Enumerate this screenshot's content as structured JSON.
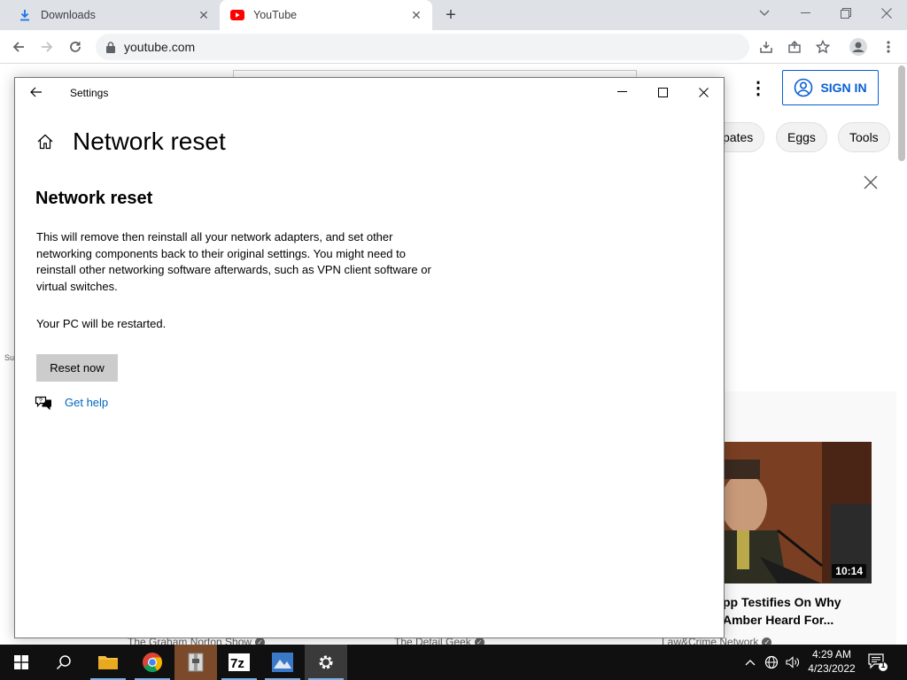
{
  "browser": {
    "tabs": [
      {
        "label": "Downloads",
        "icon": "download-icon",
        "active": false
      },
      {
        "label": "YouTube",
        "icon": "youtube-icon",
        "active": true
      }
    ],
    "url": "youtube.com"
  },
  "youtube": {
    "sign_in_label": "SIGN IN",
    "chips": [
      "pates",
      "Eggs",
      "Tools"
    ],
    "partial_left_text": "Su",
    "video": {
      "duration": "10:14",
      "title_line1": "pp Testifies On Why",
      "title_line2": "Amber Heard For..."
    },
    "channels": [
      "The Graham Norton Show",
      "The Detail Geek",
      "Law&Crime Network"
    ]
  },
  "settings": {
    "window_title": "Settings",
    "page_title": "Network reset",
    "section_title": "Network reset",
    "description": "This will remove then reinstall all your network adapters, and set other networking components back to their original settings. You might need to reinstall other networking software afterwards, such as VPN client software or virtual switches.",
    "restart_note": "Your PC will be restarted.",
    "reset_button": "Reset now",
    "help_link": "Get help"
  },
  "taskbar": {
    "time": "4:29 AM",
    "date": "4/23/2022",
    "notification_count": "1"
  },
  "colors": {
    "link_blue": "#0067c0",
    "youtube_blue": "#065fd4",
    "taskbar_bg": "#101010"
  }
}
